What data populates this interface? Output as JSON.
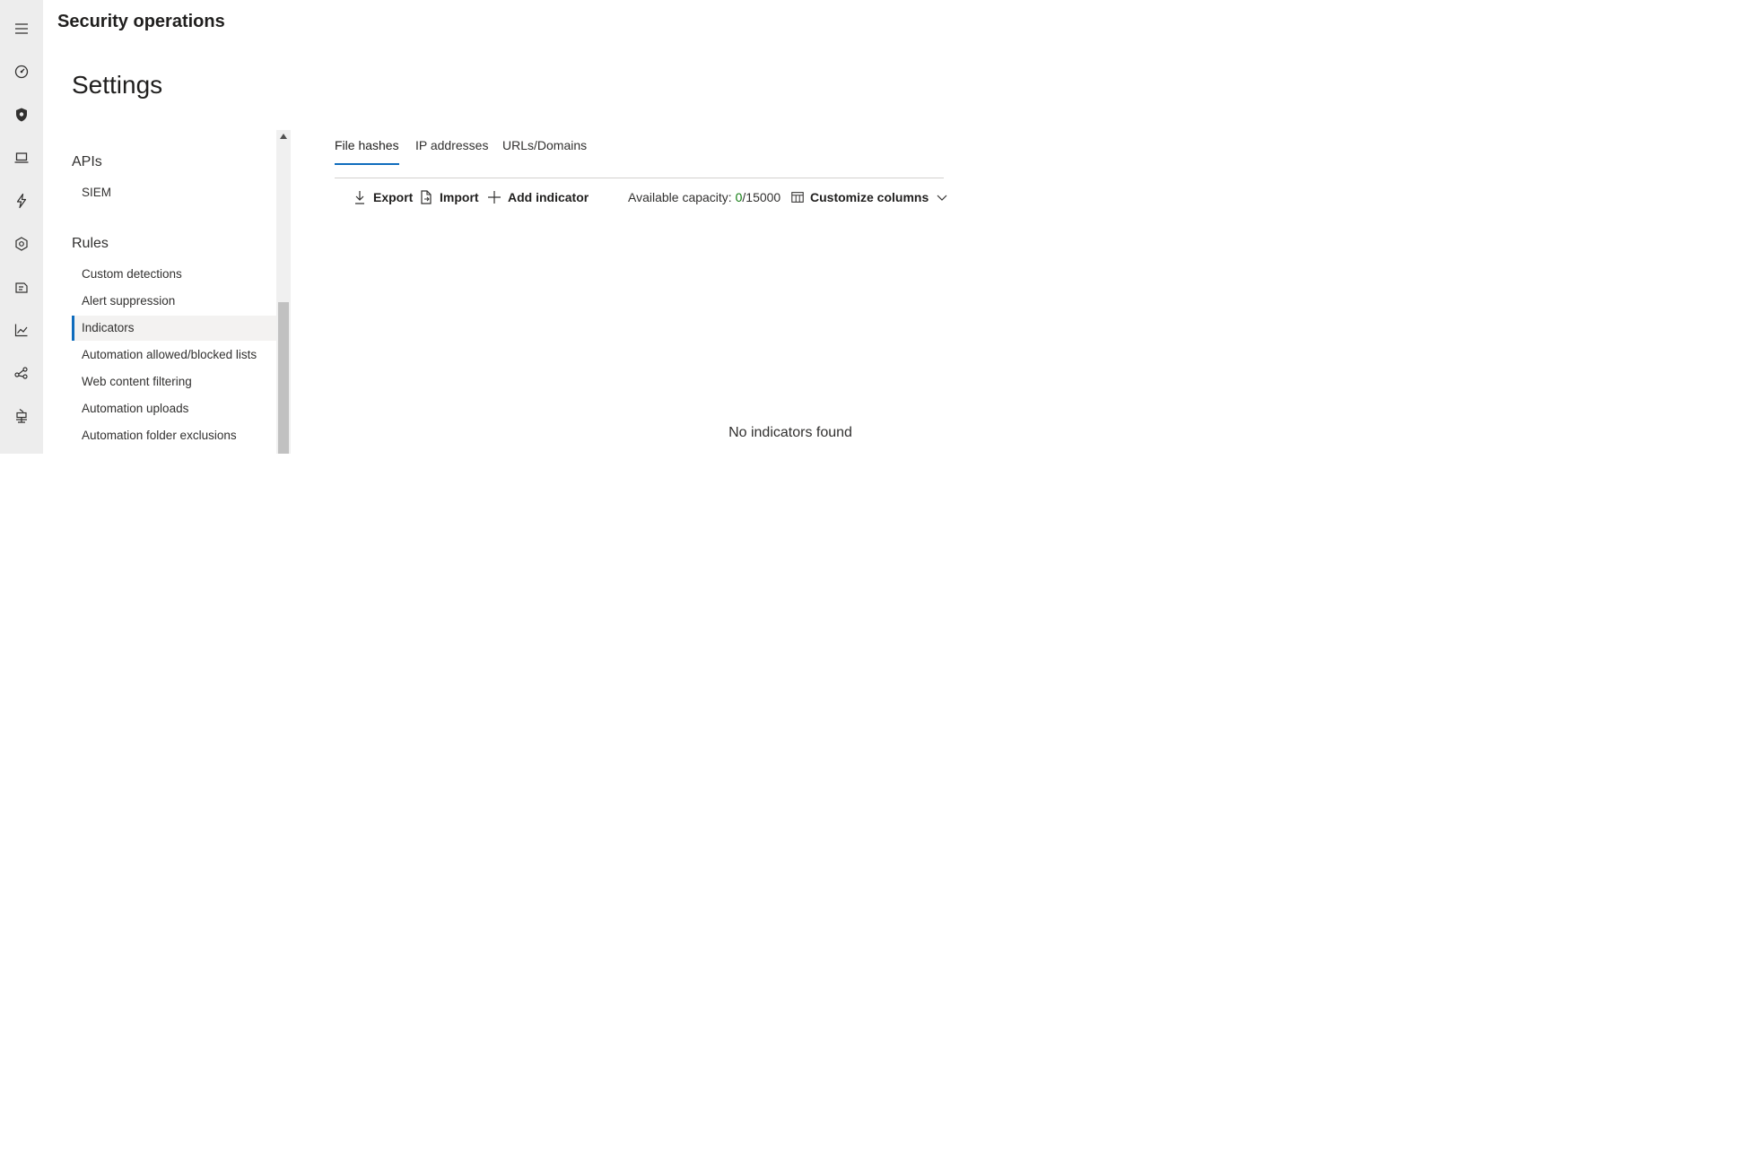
{
  "app": {
    "title": "Security operations"
  },
  "rail": {
    "icons": [
      "menu-icon",
      "dashboard-icon",
      "shield-icon",
      "laptop-icon",
      "bolt-icon",
      "hexagon-icon",
      "package-icon",
      "chart-icon",
      "share-icon",
      "robot-icon"
    ]
  },
  "page": {
    "title": "Settings"
  },
  "settings_nav": {
    "groups": [
      {
        "title": "APIs",
        "items": [
          {
            "label": "SIEM"
          }
        ]
      },
      {
        "title": "Rules",
        "items": [
          {
            "label": "Custom detections"
          },
          {
            "label": "Alert suppression"
          },
          {
            "label": "Indicators",
            "selected": true
          },
          {
            "label": "Automation allowed/blocked lists"
          },
          {
            "label": "Web content filtering"
          },
          {
            "label": "Automation uploads"
          },
          {
            "label": "Automation folder exclusions"
          }
        ]
      }
    ]
  },
  "tabs": [
    {
      "label": "File hashes",
      "active": true
    },
    {
      "label": "IP addresses"
    },
    {
      "label": "URLs/Domains"
    }
  ],
  "toolbar": {
    "export_label": "Export",
    "import_label": "Import",
    "add_indicator_label": "Add indicator",
    "capacity_label": "Available capacity:",
    "capacity_used": "0",
    "capacity_total": "/15000",
    "customize_columns_label": "Customize columns"
  },
  "empty_state": {
    "message": "No indicators found"
  },
  "colors": {
    "accent": "#0f6cbd",
    "rail_bg": "#ededed",
    "capacity_used": "#107c10"
  }
}
